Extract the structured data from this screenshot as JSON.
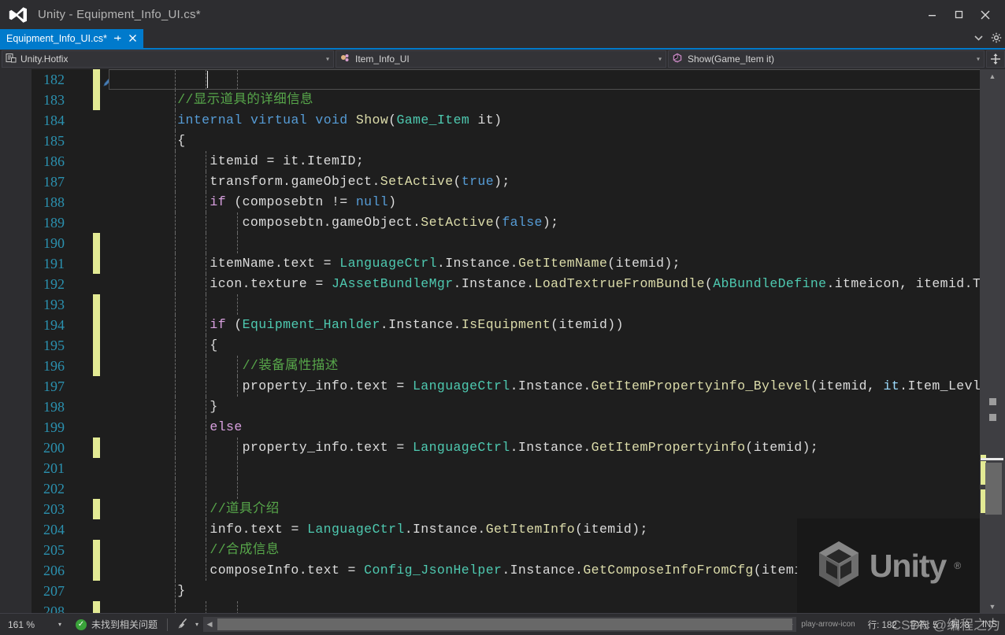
{
  "window": {
    "title": "Unity - Equipment_Info_UI.cs*",
    "logo_icon": "visual-studio-logo",
    "minimize_label": "—",
    "maximize_label": "❐",
    "close_label": "✕"
  },
  "tabs": [
    {
      "label": "Equipment_Info_UI.cs*",
      "pin_icon": "pin-icon",
      "close_icon": "close-icon",
      "active": true
    }
  ],
  "tabstrip_right": {
    "chevron_icon": "chevron-down-icon",
    "settings_icon": "gear-icon"
  },
  "navbar": {
    "project": {
      "label": "Unity.Hotfix",
      "icon": "project-icon",
      "arrow": "▾"
    },
    "type": {
      "label": "Item_Info_UI",
      "icon": "class-icon",
      "arrow": "▾"
    },
    "member": {
      "label": "Show(Game_Item it)",
      "icon": "method-icon",
      "arrow": "▾"
    },
    "split_icon": "split-view-icon"
  },
  "editor": {
    "first_line_number": 182,
    "caret_line": 182,
    "lines": [
      {
        "n": 182,
        "change": true,
        "bookmark": true,
        "collapse": "none",
        "current": true,
        "tokens": []
      },
      {
        "n": 183,
        "change": true,
        "collapse": "none",
        "tokens": [
          {
            "t": "    ",
            "c": "plain"
          },
          {
            "t": "//显示道具的详细信息",
            "c": "comment"
          }
        ]
      },
      {
        "n": 184,
        "change": false,
        "collapse": "minus",
        "tokens": [
          {
            "t": "    ",
            "c": "plain"
          },
          {
            "t": "internal",
            "c": "kw"
          },
          {
            "t": " ",
            "c": "plain"
          },
          {
            "t": "virtual",
            "c": "kw"
          },
          {
            "t": " ",
            "c": "plain"
          },
          {
            "t": "void",
            "c": "kw"
          },
          {
            "t": " ",
            "c": "plain"
          },
          {
            "t": "Show",
            "c": "method"
          },
          {
            "t": "(",
            "c": "punct"
          },
          {
            "t": "Game_Item",
            "c": "type"
          },
          {
            "t": " it)",
            "c": "plain"
          }
        ]
      },
      {
        "n": 185,
        "change": false,
        "collapse": "none",
        "tokens": [
          {
            "t": "    {",
            "c": "plain"
          }
        ]
      },
      {
        "n": 186,
        "change": false,
        "collapse": "none",
        "tokens": [
          {
            "t": "        itemid = it",
            "c": "plain"
          },
          {
            "t": ".",
            "c": "punct"
          },
          {
            "t": "ItemID;",
            "c": "plain"
          }
        ]
      },
      {
        "n": 187,
        "change": false,
        "collapse": "none",
        "tokens": [
          {
            "t": "        transform",
            "c": "plain"
          },
          {
            "t": ".",
            "c": "punct"
          },
          {
            "t": "gameObject",
            "c": "plain"
          },
          {
            "t": ".",
            "c": "punct"
          },
          {
            "t": "SetActive",
            "c": "method"
          },
          {
            "t": "(",
            "c": "punct"
          },
          {
            "t": "true",
            "c": "lit"
          },
          {
            "t": ");",
            "c": "punct"
          }
        ]
      },
      {
        "n": 188,
        "change": false,
        "collapse": "none",
        "tokens": [
          {
            "t": "        ",
            "c": "plain"
          },
          {
            "t": "if",
            "c": "ctrlkw"
          },
          {
            "t": " (composebtn != ",
            "c": "plain"
          },
          {
            "t": "null",
            "c": "lit"
          },
          {
            "t": ")",
            "c": "plain"
          }
        ]
      },
      {
        "n": 189,
        "change": false,
        "collapse": "none",
        "tokens": [
          {
            "t": "            composebtn",
            "c": "plain"
          },
          {
            "t": ".",
            "c": "punct"
          },
          {
            "t": "gameObject",
            "c": "plain"
          },
          {
            "t": ".",
            "c": "punct"
          },
          {
            "t": "SetActive",
            "c": "method"
          },
          {
            "t": "(",
            "c": "punct"
          },
          {
            "t": "false",
            "c": "lit"
          },
          {
            "t": ");",
            "c": "punct"
          }
        ]
      },
      {
        "n": 190,
        "change": true,
        "collapse": "none",
        "tokens": []
      },
      {
        "n": 191,
        "change": true,
        "collapse": "none",
        "tokens": [
          {
            "t": "        itemName",
            "c": "plain"
          },
          {
            "t": ".",
            "c": "punct"
          },
          {
            "t": "text = ",
            "c": "plain"
          },
          {
            "t": "LanguageCtrl",
            "c": "type"
          },
          {
            "t": ".",
            "c": "punct"
          },
          {
            "t": "Instance",
            "c": "plain"
          },
          {
            "t": ".",
            "c": "punct"
          },
          {
            "t": "GetItemName",
            "c": "method"
          },
          {
            "t": "(itemid);",
            "c": "plain"
          }
        ]
      },
      {
        "n": 192,
        "change": false,
        "collapse": "none",
        "tokens": [
          {
            "t": "        icon",
            "c": "plain"
          },
          {
            "t": ".",
            "c": "punct"
          },
          {
            "t": "texture = ",
            "c": "plain"
          },
          {
            "t": "JAssetBundleMgr",
            "c": "type"
          },
          {
            "t": ".",
            "c": "punct"
          },
          {
            "t": "Instance",
            "c": "plain"
          },
          {
            "t": ".",
            "c": "punct"
          },
          {
            "t": "LoadTextrueFromBundle",
            "c": "method"
          },
          {
            "t": "(",
            "c": "punct"
          },
          {
            "t": "AbBundleDefine",
            "c": "type"
          },
          {
            "t": ".",
            "c": "punct"
          },
          {
            "t": "itmeicon, ",
            "c": "plain"
          },
          {
            "t": "itemid",
            "c": "plain"
          },
          {
            "t": ".",
            "c": "punct"
          },
          {
            "t": "ToS",
            "c": "plain"
          }
        ]
      },
      {
        "n": 193,
        "change": true,
        "collapse": "none",
        "tokens": []
      },
      {
        "n": 194,
        "change": true,
        "collapse": "minus",
        "tokens": [
          {
            "t": "        ",
            "c": "plain"
          },
          {
            "t": "if",
            "c": "ctrlkw"
          },
          {
            "t": " (",
            "c": "plain"
          },
          {
            "t": "Equipment_Hanlder",
            "c": "type"
          },
          {
            "t": ".",
            "c": "punct"
          },
          {
            "t": "Instance",
            "c": "plain"
          },
          {
            "t": ".",
            "c": "punct"
          },
          {
            "t": "IsEquipment",
            "c": "method"
          },
          {
            "t": "(itemid))",
            "c": "plain"
          }
        ]
      },
      {
        "n": 195,
        "change": true,
        "collapse": "none",
        "tokens": [
          {
            "t": "        {",
            "c": "plain"
          }
        ]
      },
      {
        "n": 196,
        "change": true,
        "collapse": "none",
        "tokens": [
          {
            "t": "            ",
            "c": "plain"
          },
          {
            "t": "//装备属性描述",
            "c": "comment"
          }
        ]
      },
      {
        "n": 197,
        "change": false,
        "collapse": "none",
        "tokens": [
          {
            "t": "            property_info",
            "c": "plain"
          },
          {
            "t": ".",
            "c": "punct"
          },
          {
            "t": "text = ",
            "c": "plain"
          },
          {
            "t": "LanguageCtrl",
            "c": "type"
          },
          {
            "t": ".",
            "c": "punct"
          },
          {
            "t": "Instance",
            "c": "plain"
          },
          {
            "t": ".",
            "c": "punct"
          },
          {
            "t": "GetItemPropertyinfo_Bylevel",
            "c": "method"
          },
          {
            "t": "(itemid, ",
            "c": "plain"
          },
          {
            "t": "it",
            "c": "ident"
          },
          {
            "t": ".",
            "c": "punct"
          },
          {
            "t": "Item_Levl);",
            "c": "plain"
          }
        ]
      },
      {
        "n": 198,
        "change": false,
        "collapse": "tick",
        "tokens": [
          {
            "t": "        }",
            "c": "plain"
          }
        ]
      },
      {
        "n": 199,
        "change": false,
        "collapse": "none",
        "tokens": [
          {
            "t": "        ",
            "c": "plain"
          },
          {
            "t": "else",
            "c": "ctrlkw"
          }
        ]
      },
      {
        "n": 200,
        "change": true,
        "collapse": "none",
        "tokens": [
          {
            "t": "            property_info",
            "c": "plain"
          },
          {
            "t": ".",
            "c": "punct"
          },
          {
            "t": "text = ",
            "c": "plain"
          },
          {
            "t": "LanguageCtrl",
            "c": "type"
          },
          {
            "t": ".",
            "c": "punct"
          },
          {
            "t": "Instance",
            "c": "plain"
          },
          {
            "t": ".",
            "c": "punct"
          },
          {
            "t": "GetItemPropertyinfo",
            "c": "method"
          },
          {
            "t": "(itemid);",
            "c": "plain"
          }
        ]
      },
      {
        "n": 201,
        "change": false,
        "collapse": "none",
        "tokens": []
      },
      {
        "n": 202,
        "change": false,
        "collapse": "none",
        "tokens": []
      },
      {
        "n": 203,
        "change": true,
        "collapse": "none",
        "tokens": [
          {
            "t": "        ",
            "c": "plain"
          },
          {
            "t": "//道具介绍",
            "c": "comment"
          }
        ]
      },
      {
        "n": 204,
        "change": false,
        "collapse": "none",
        "tokens": [
          {
            "t": "        info",
            "c": "plain"
          },
          {
            "t": ".",
            "c": "punct"
          },
          {
            "t": "text = ",
            "c": "plain"
          },
          {
            "t": "LanguageCtrl",
            "c": "type"
          },
          {
            "t": ".",
            "c": "punct"
          },
          {
            "t": "Instance",
            "c": "plain"
          },
          {
            "t": ".",
            "c": "punct"
          },
          {
            "t": "GetItemInfo",
            "c": "method"
          },
          {
            "t": "(itemid);",
            "c": "plain"
          }
        ]
      },
      {
        "n": 205,
        "change": true,
        "collapse": "none",
        "tokens": [
          {
            "t": "        ",
            "c": "plain"
          },
          {
            "t": "//合成信息",
            "c": "comment"
          }
        ]
      },
      {
        "n": 206,
        "change": true,
        "collapse": "none",
        "tokens": [
          {
            "t": "        composeInfo",
            "c": "plain"
          },
          {
            "t": ".",
            "c": "punct"
          },
          {
            "t": "text = ",
            "c": "plain"
          },
          {
            "t": "Config_JsonHelper",
            "c": "type"
          },
          {
            "t": ".",
            "c": "punct"
          },
          {
            "t": "Instance",
            "c": "plain"
          },
          {
            "t": ".",
            "c": "punct"
          },
          {
            "t": "GetComposeInfoFromCfg",
            "c": "method"
          },
          {
            "t": "(itemid);",
            "c": "plain"
          }
        ]
      },
      {
        "n": 207,
        "change": false,
        "collapse": "tick",
        "tokens": [
          {
            "t": "    }",
            "c": "plain"
          }
        ]
      },
      {
        "n": 208,
        "change": true,
        "collapse": "none",
        "tokens": []
      }
    ]
  },
  "scrollbar": {
    "up_arrow": "▲",
    "down_arrow": "▼",
    "left_arrow": "◀",
    "right_arrow": "▶"
  },
  "watermarks": {
    "unity_label": "Unity",
    "unity_reg": "®",
    "unity_icon": "unity-cube-logo",
    "csdn_text": "CSDN @编程之力"
  },
  "statusbar": {
    "zoom": "161 %",
    "zoom_arrow": "▾",
    "problems_icon": "check-circle-icon",
    "problems_text": "未找到相关问题",
    "broom_icon": "broom-icon",
    "broom_arrow": "▾",
    "play_icon": "play-arrow-icon",
    "line_label": "行: 182",
    "char_label": "字符: 5",
    "col_label": "列: 8",
    "insert_mode": "INS"
  }
}
